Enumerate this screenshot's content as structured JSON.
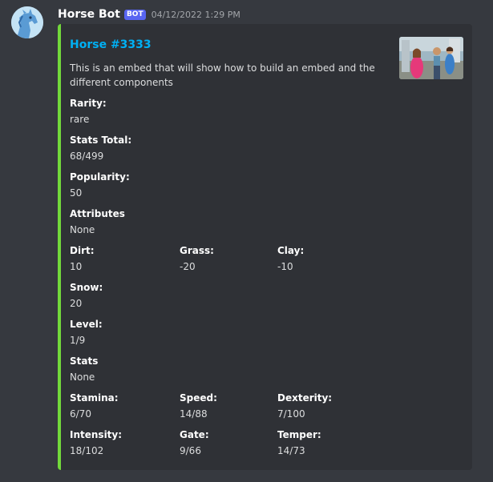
{
  "message": {
    "author": "Horse Bot",
    "bot_tag": "BOT",
    "timestamp": "04/12/2022 1:29 PM",
    "avatar_icon": "horse-avatar",
    "embed": {
      "accent_color": "#72d93b",
      "title": "Horse #3333",
      "title_color": "#00b0f4",
      "description": "This is an embed that will show how to build an embed and the different components",
      "thumbnail_icon": "distracted-boyfriend-meme-thumbnail",
      "thumbnail_labels": [
        "a + b",
        "a + b",
        "a*b + c"
      ],
      "fields": [
        {
          "name": "Rarity:",
          "value": "rare"
        },
        {
          "name": "Stats Total:",
          "value": "68/499"
        },
        {
          "name": "Popularity:",
          "value": "50"
        },
        {
          "name": "Attributes",
          "value": "None"
        },
        {
          "name": "Dirt:",
          "value": "10"
        },
        {
          "name": "Grass:",
          "value": "-20"
        },
        {
          "name": "Clay:",
          "value": "-10"
        },
        {
          "name": "Snow:",
          "value": "20"
        },
        {
          "name": "Level:",
          "value": "1/9"
        },
        {
          "name": "Stats",
          "value": "None"
        },
        {
          "name": "Stamina:",
          "value": "6/70"
        },
        {
          "name": "Speed:",
          "value": "14/88"
        },
        {
          "name": "Dexterity:",
          "value": "7/100"
        },
        {
          "name": "Intensity:",
          "value": "18/102"
        },
        {
          "name": "Gate:",
          "value": "9/66"
        },
        {
          "name": "Temper:",
          "value": "14/73"
        }
      ]
    }
  }
}
